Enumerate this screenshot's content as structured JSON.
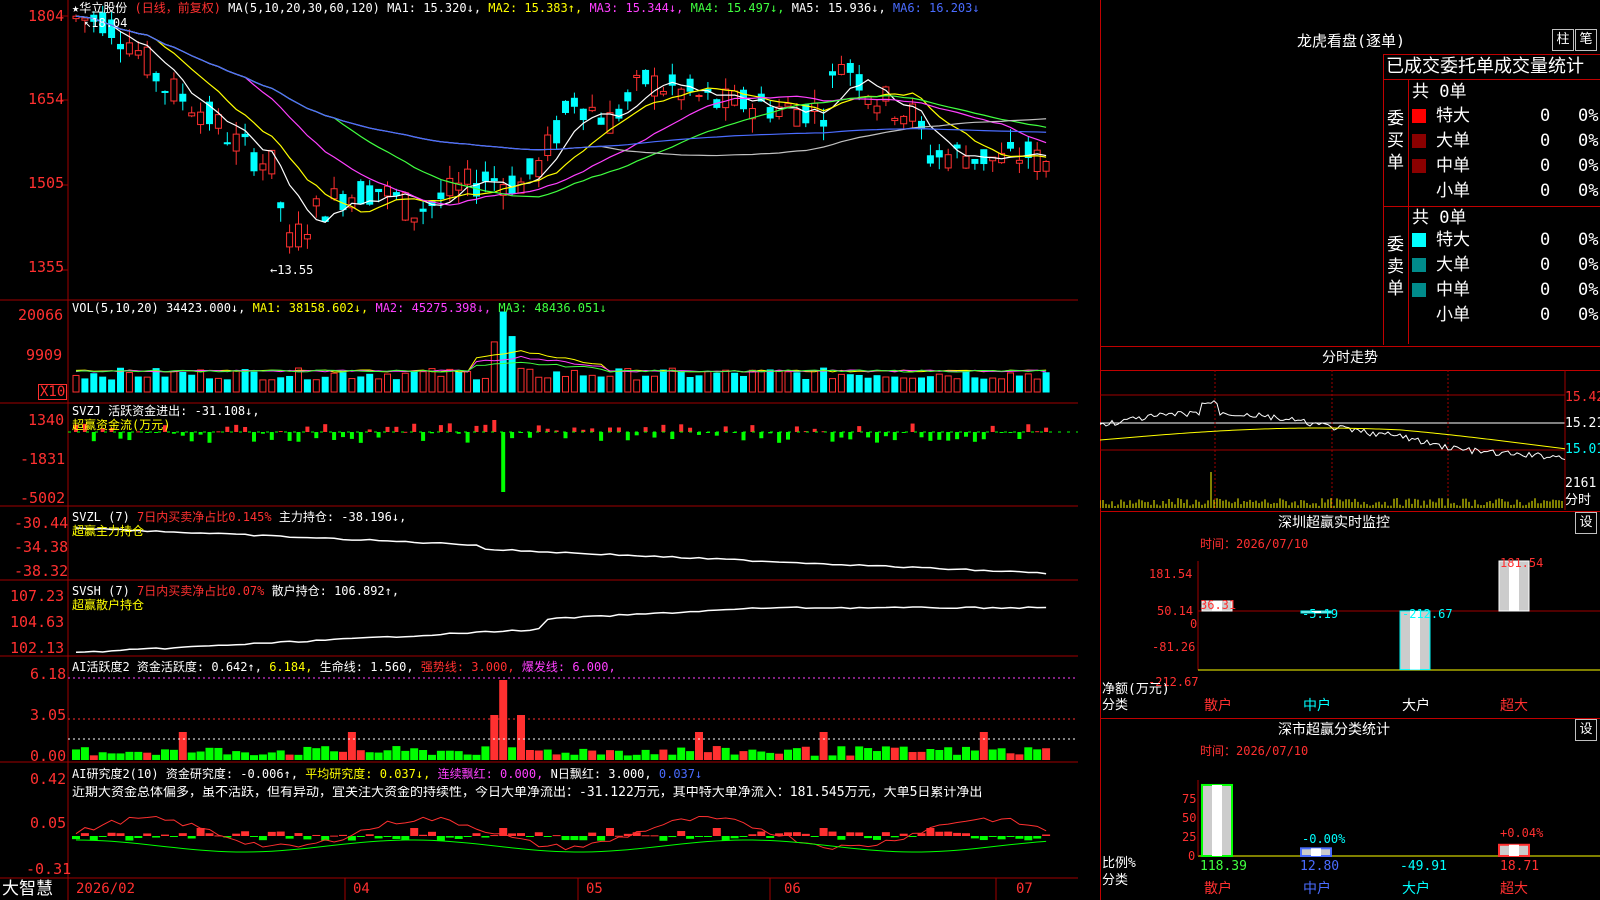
{
  "colors": {
    "up": "#ff3030",
    "down": "#00ffff",
    "ma1": "#ffffff",
    "ma2": "#ffff00",
    "ma3": "#ff40ff",
    "ma4": "#40ff40",
    "ma5": "#c0c0c0",
    "ma6": "#4a6cff",
    "grid": "#a00000"
  },
  "main": {
    "stock_name": "华立股份",
    "mode": "(日线，前复权)",
    "ma_params": "MA(5,10,20,30,60,120)",
    "ma1": "MA1: 15.320↓,",
    "ma2": "MA2: 15.383↑,",
    "ma3": "MA3: 15.344↓,",
    "ma4": "MA4: 15.497↓,",
    "ma5": "MA5: 15.936↓,",
    "ma6": "MA6: 16.203↓",
    "high_label": "18.04",
    "low_label": "←13.55",
    "y_labels": [
      "1804",
      "1654",
      "1505",
      "1355"
    ]
  },
  "vol": {
    "params": "VOL(5,10,20)",
    "value": "34423.000↓,",
    "ma1": "MA1: 38158.602↓,",
    "ma2": "MA2: 45275.398↓,",
    "ma3": "MA3: 48436.051↓",
    "y_labels": [
      "20066",
      "9909"
    ],
    "unit": "X10"
  },
  "svzj": {
    "title": "SVZJ  活跃资金进出: -31.108↓,",
    "sub": "超赢资金流(万元)",
    "y_labels": [
      "1340",
      "-1831",
      "-5002"
    ]
  },
  "svzl": {
    "title": "SVZL (7)",
    "desc": "7日内买卖净占比0.145%",
    "val": "主力持仓: -38.196↓,",
    "sub": "超赢主力持仓",
    "y_labels": [
      "-30.44",
      "-34.38",
      "-38.32"
    ]
  },
  "svsh": {
    "title": "SVSH (7)",
    "desc": "7日内买卖净占比0.07%",
    "val": "散户持仓: 106.892↑,",
    "sub": "超赢散户持仓",
    "y_labels": [
      "107.23",
      "104.63",
      "102.13"
    ]
  },
  "ai1": {
    "title": "AI活跃度2",
    "a": "资金活跃度: 0.642↑,",
    "b": "6.184,",
    "c": "生命线: 1.560,",
    "d": "强势线: 3.000,",
    "e": "爆发线: 6.000,",
    "y_labels": [
      "6.18",
      "3.05",
      "0.00"
    ]
  },
  "ai2": {
    "title": "AI研究度2(10)",
    "a": "资金研究度: -0.006↑,",
    "b": "平均研究度: 0.037↓,",
    "c": "连续飘红: 0.000,",
    "d": "N日飘红: 3.000,",
    "e": "0.037↓",
    "text": "近期大资金总体偏多，虽不活跃，但有异动，宜关注大资金的持续性，今日大单净流出：-31.122万元，其中特大单净流入：181.545万元，大单5日累计净出",
    "y_labels": [
      "0.42",
      "0.05",
      "-0.31"
    ]
  },
  "xaxis": {
    "labels": [
      "2026/02",
      "04",
      "05",
      "06",
      "07"
    ]
  },
  "brand": "大智慧",
  "lhb": {
    "title": "龙虎看盘(逐单)",
    "btn_pillar": "柱",
    "btn_pen": "笔",
    "tabs": "已成交委托单成交量统计",
    "buy_side": "委买单",
    "sell_side": "委卖单",
    "buy_total": "共 0单",
    "sell_total": "共 0单",
    "buy_rows": [
      {
        "label": "特大",
        "n": "0",
        "p": "0%"
      },
      {
        "label": "大单",
        "n": "0",
        "p": "0%"
      },
      {
        "label": "中单",
        "n": "0",
        "p": "0%"
      },
      {
        "label": "小单",
        "n": "0",
        "p": "0%"
      }
    ],
    "sell_rows": [
      {
        "label": "特大",
        "n": "0",
        "p": "0%"
      },
      {
        "label": "大单",
        "n": "0",
        "p": "0%"
      },
      {
        "label": "中单",
        "n": "0",
        "p": "0%"
      },
      {
        "label": "小单",
        "n": "0",
        "p": "0%"
      }
    ]
  },
  "fenshi": {
    "title": "分时走势",
    "prices": [
      "15.42",
      "15.21",
      "15.01"
    ],
    "vol": "2161",
    "vol_unit": "分时"
  },
  "monitor": {
    "title": "深圳超赢实时监控",
    "btn": "设",
    "time": "时间：2026/07/10",
    "y_labels": [
      "181.54",
      "50.14",
      "0",
      "-81.26",
      "-212.67"
    ],
    "ylabel1": "净额(万元)",
    "ylabel2": "分类",
    "categories": [
      "散户",
      "中户",
      "大户",
      "超大"
    ],
    "values": [
      36.31,
      -5.19,
      -212.67,
      181.54
    ],
    "value_labels": [
      "36.31",
      "-5.19",
      "-212.67",
      "181.54"
    ]
  },
  "classify": {
    "title": "深市超赢分类统计",
    "btn": "设",
    "time": "时间：2026/07/10",
    "y_labels": [
      "75",
      "50",
      "25",
      "0"
    ],
    "ylabel1": "比例%",
    "ylabel2": "分类",
    "categories": [
      "散户",
      "中户",
      "大户",
      "超大"
    ],
    "pct_labels": [
      "-0.00%",
      "+0.04%"
    ],
    "values": [
      "118.39",
      "12.80",
      "-49.91",
      "18.71"
    ]
  }
}
